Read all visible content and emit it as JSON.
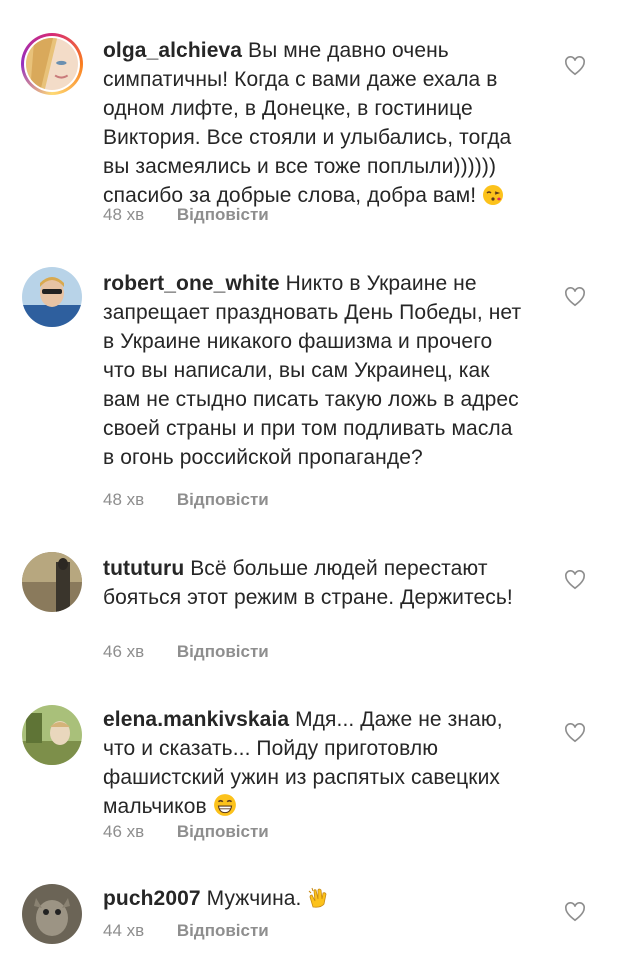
{
  "comments": [
    {
      "username": "olga_alchieva",
      "text": "Вы мне давно очень симпатичны! Когда с вами даже ехала в одном лифте, в Донецке, в гостинице Виктория. Все стояли и улыбались, тогда вы засмеялись и все тоже поплыли)))))) спасибо за добрые слова, добра вам!",
      "emoji": "kissing-face-emoji",
      "time": "48 хв",
      "reply": "Відповісти"
    },
    {
      "username": "robert_one_white",
      "text": "Никто в Украине не запрещает праздновать День Победы, нет в Украине никакого фашизма и прочего что вы написали,  вы сам Украинец,  как вам не стыдно писать такую ложь в адрес своей страны и при том подливать масла в огонь российской пропаганде?",
      "time": "48 хв",
      "reply": "Відповісти"
    },
    {
      "username": "tututuru",
      "text": "Всё больше людей перестают бояться этот режим в стране. Держитесь!",
      "time": "46 хв",
      "reply": "Відповісти"
    },
    {
      "username": "elena.mankivskaia",
      "text": "Мдя... Даже не знаю, что и сказать... Пойду приготовлю фашистский ужин из распятых савецких мальчиков",
      "emoji": "grinning-face-emoji",
      "time": "46 хв",
      "reply": "Відповісти"
    },
    {
      "username": "puch2007",
      "text": "Мужчина.",
      "emoji": "clapping-hands-emoji",
      "time": "44 хв",
      "reply": "Відповісти"
    }
  ],
  "colors": {
    "text": "#262626",
    "muted": "#8e8e8e",
    "background": "#ffffff"
  }
}
